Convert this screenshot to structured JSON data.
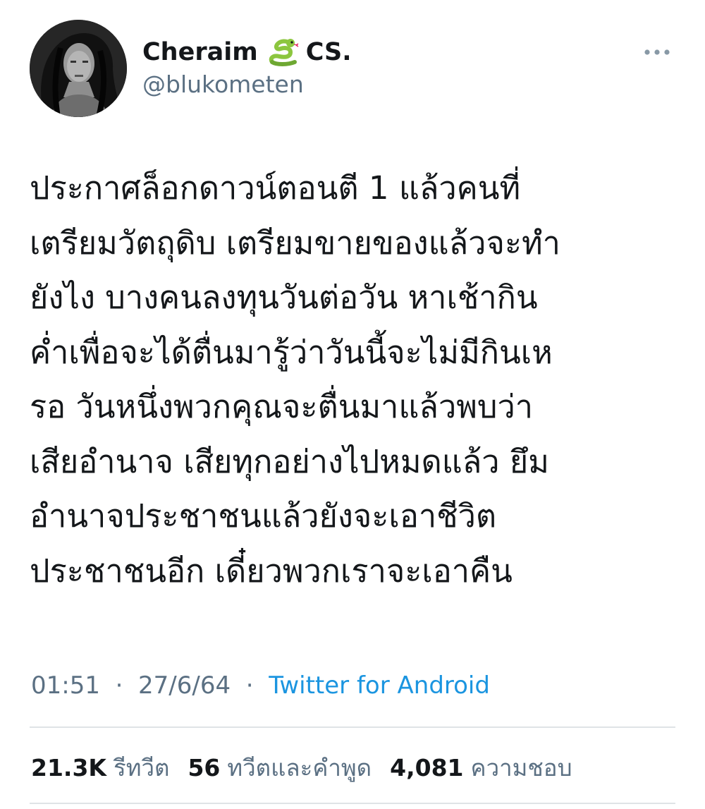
{
  "author": {
    "display_name_part1": "Cheraim",
    "display_name_emoji": "snake-emoji",
    "display_name_part2": "CS.",
    "handle": "@blukometen"
  },
  "tweet": {
    "lines": [
      "ประกาศล็อกดาวน์ตอนตี 1 แล้วคนที่",
      "เตรียมวัตถุดิบ เตรียมขายของแล้วจะทำ",
      "ยังไง บางคนลงทุนวันต่อวัน หาเช้ากิน",
      "ค่ำเพื่อจะได้ตื่นมารู้ว่าวันนี้จะไม่มีกินเห",
      "รอ วันหนึ่งพวกคุณจะตื่นมาแล้วพบว่า",
      "เสียอำนาจ เสียทุกอย่างไปหมดแล้ว ยึม",
      "อำนาจประชาชนแล้วยังจะเอาชีวิต",
      "ประชาชนอีก เดี๋ยวพวกเราจะเอาคืน"
    ],
    "time": "01:51",
    "separator": "·",
    "date": "27/6/64",
    "source": "Twitter for Android"
  },
  "stats": {
    "retweets_count": "21.3K",
    "retweets_label": "รีทวีต",
    "quotes_count": "56",
    "quotes_label": "ทวีตและคำพูด",
    "likes_count": "4,081",
    "likes_label": "ความชอบ"
  },
  "icons": {
    "more": "more-horizontal-icon",
    "avatar": "profile-avatar"
  },
  "colors": {
    "text_primary": "#14171a",
    "text_secondary": "#5b7083",
    "link": "#1b95e0",
    "divider": "#dfe3e6",
    "snake_green": "#8cc63f"
  }
}
